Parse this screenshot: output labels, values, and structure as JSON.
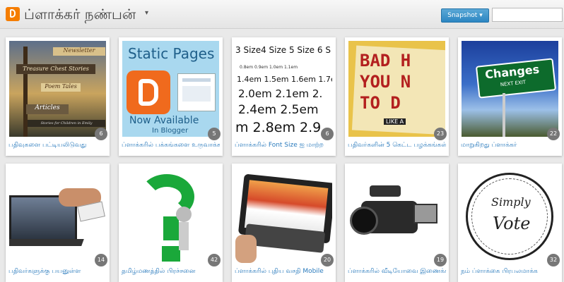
{
  "header": {
    "blog_title": "ப்ளாக்கர் நண்பன்",
    "view_button": "Snapshot",
    "search_placeholder": ""
  },
  "posts": [
    {
      "caption": "பதிவுகளை பட்டியலிடுவது",
      "count": "6",
      "thumb_text": [
        "Newsletter",
        "Treasure Chest Stories",
        "Poem Tales",
        "Articles",
        "Stories for Children in Emily"
      ]
    },
    {
      "caption": "ப்ளாக்கரில் பக்கங்களை உருவாக்க",
      "count": "5",
      "thumb_text": [
        "Static Pages",
        "Now Available",
        "In Blogger"
      ]
    },
    {
      "caption": "ப்ளாக்கரில் Font Size ஐ மாற்ற",
      "count": "6",
      "thumb_text": [
        "3 Size4 Size 5 Size 6 S",
        "0.8em 0.9em 1.0em 1.1em",
        "1.4em 1.5em 1.6em 1.7e",
        "2.0em 2.1em 2.",
        "2.4em 2.5em",
        "m 2.8em 2.9"
      ]
    },
    {
      "caption": "பதிவர்களின் 5 கெட்ட பழக்கங்கள்",
      "count": "23",
      "thumb_text": [
        "BAD H",
        "YOU N",
        "TO D",
        "LIKE A"
      ]
    },
    {
      "caption": "மாறுகிறது ப்ளாக்கர்",
      "count": "22",
      "thumb_text": [
        "Changes",
        "NEXT EXIT"
      ]
    },
    {
      "caption": "பதிவர்களுக்கு பயனுள்ள",
      "count": "14",
      "thumb_text": []
    },
    {
      "caption": "தமிழ்மணத்தில் பிரச்சனை",
      "count": "42",
      "thumb_text": []
    },
    {
      "caption": "ப்ளாக்கரில் புதிய வசதி Mobile",
      "count": "20",
      "thumb_text": []
    },
    {
      "caption": "ப்ளாக்கரில் வீடியோவை இணைக்க",
      "count": "19",
      "thumb_text": []
    },
    {
      "caption": "நம் ப்ளாக்கை பிரபலமாக்க",
      "count": "32",
      "thumb_text": [
        "Simply",
        "Vote"
      ]
    }
  ],
  "colors": {
    "accent": "#2b7bbd",
    "button": "#2c86c2",
    "brand": "#f57d00"
  }
}
